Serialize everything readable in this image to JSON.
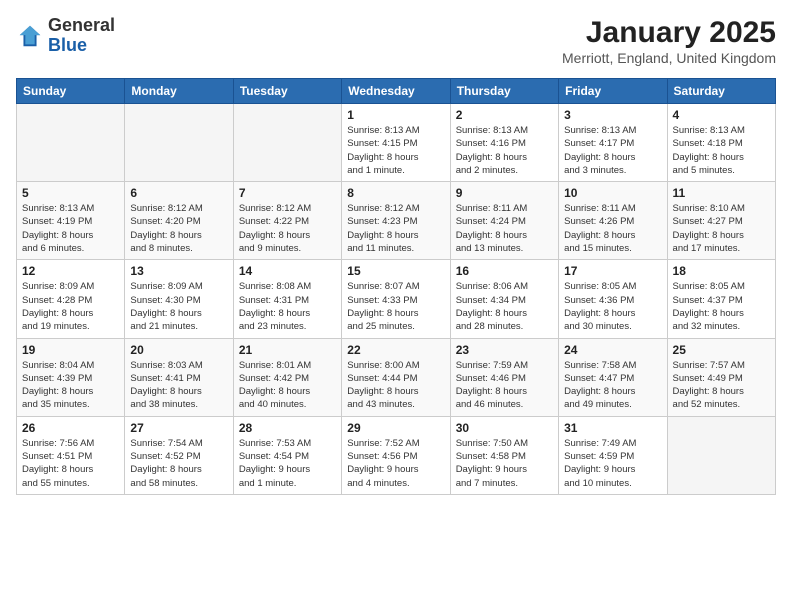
{
  "header": {
    "logo_general": "General",
    "logo_blue": "Blue",
    "month_title": "January 2025",
    "location": "Merriott, England, United Kingdom"
  },
  "weekdays": [
    "Sunday",
    "Monday",
    "Tuesday",
    "Wednesday",
    "Thursday",
    "Friday",
    "Saturday"
  ],
  "weeks": [
    [
      {
        "day": "",
        "info": ""
      },
      {
        "day": "",
        "info": ""
      },
      {
        "day": "",
        "info": ""
      },
      {
        "day": "1",
        "info": "Sunrise: 8:13 AM\nSunset: 4:15 PM\nDaylight: 8 hours\nand 1 minute."
      },
      {
        "day": "2",
        "info": "Sunrise: 8:13 AM\nSunset: 4:16 PM\nDaylight: 8 hours\nand 2 minutes."
      },
      {
        "day": "3",
        "info": "Sunrise: 8:13 AM\nSunset: 4:17 PM\nDaylight: 8 hours\nand 3 minutes."
      },
      {
        "day": "4",
        "info": "Sunrise: 8:13 AM\nSunset: 4:18 PM\nDaylight: 8 hours\nand 5 minutes."
      }
    ],
    [
      {
        "day": "5",
        "info": "Sunrise: 8:13 AM\nSunset: 4:19 PM\nDaylight: 8 hours\nand 6 minutes."
      },
      {
        "day": "6",
        "info": "Sunrise: 8:12 AM\nSunset: 4:20 PM\nDaylight: 8 hours\nand 8 minutes."
      },
      {
        "day": "7",
        "info": "Sunrise: 8:12 AM\nSunset: 4:22 PM\nDaylight: 8 hours\nand 9 minutes."
      },
      {
        "day": "8",
        "info": "Sunrise: 8:12 AM\nSunset: 4:23 PM\nDaylight: 8 hours\nand 11 minutes."
      },
      {
        "day": "9",
        "info": "Sunrise: 8:11 AM\nSunset: 4:24 PM\nDaylight: 8 hours\nand 13 minutes."
      },
      {
        "day": "10",
        "info": "Sunrise: 8:11 AM\nSunset: 4:26 PM\nDaylight: 8 hours\nand 15 minutes."
      },
      {
        "day": "11",
        "info": "Sunrise: 8:10 AM\nSunset: 4:27 PM\nDaylight: 8 hours\nand 17 minutes."
      }
    ],
    [
      {
        "day": "12",
        "info": "Sunrise: 8:09 AM\nSunset: 4:28 PM\nDaylight: 8 hours\nand 19 minutes."
      },
      {
        "day": "13",
        "info": "Sunrise: 8:09 AM\nSunset: 4:30 PM\nDaylight: 8 hours\nand 21 minutes."
      },
      {
        "day": "14",
        "info": "Sunrise: 8:08 AM\nSunset: 4:31 PM\nDaylight: 8 hours\nand 23 minutes."
      },
      {
        "day": "15",
        "info": "Sunrise: 8:07 AM\nSunset: 4:33 PM\nDaylight: 8 hours\nand 25 minutes."
      },
      {
        "day": "16",
        "info": "Sunrise: 8:06 AM\nSunset: 4:34 PM\nDaylight: 8 hours\nand 28 minutes."
      },
      {
        "day": "17",
        "info": "Sunrise: 8:05 AM\nSunset: 4:36 PM\nDaylight: 8 hours\nand 30 minutes."
      },
      {
        "day": "18",
        "info": "Sunrise: 8:05 AM\nSunset: 4:37 PM\nDaylight: 8 hours\nand 32 minutes."
      }
    ],
    [
      {
        "day": "19",
        "info": "Sunrise: 8:04 AM\nSunset: 4:39 PM\nDaylight: 8 hours\nand 35 minutes."
      },
      {
        "day": "20",
        "info": "Sunrise: 8:03 AM\nSunset: 4:41 PM\nDaylight: 8 hours\nand 38 minutes."
      },
      {
        "day": "21",
        "info": "Sunrise: 8:01 AM\nSunset: 4:42 PM\nDaylight: 8 hours\nand 40 minutes."
      },
      {
        "day": "22",
        "info": "Sunrise: 8:00 AM\nSunset: 4:44 PM\nDaylight: 8 hours\nand 43 minutes."
      },
      {
        "day": "23",
        "info": "Sunrise: 7:59 AM\nSunset: 4:46 PM\nDaylight: 8 hours\nand 46 minutes."
      },
      {
        "day": "24",
        "info": "Sunrise: 7:58 AM\nSunset: 4:47 PM\nDaylight: 8 hours\nand 49 minutes."
      },
      {
        "day": "25",
        "info": "Sunrise: 7:57 AM\nSunset: 4:49 PM\nDaylight: 8 hours\nand 52 minutes."
      }
    ],
    [
      {
        "day": "26",
        "info": "Sunrise: 7:56 AM\nSunset: 4:51 PM\nDaylight: 8 hours\nand 55 minutes."
      },
      {
        "day": "27",
        "info": "Sunrise: 7:54 AM\nSunset: 4:52 PM\nDaylight: 8 hours\nand 58 minutes."
      },
      {
        "day": "28",
        "info": "Sunrise: 7:53 AM\nSunset: 4:54 PM\nDaylight: 9 hours\nand 1 minute."
      },
      {
        "day": "29",
        "info": "Sunrise: 7:52 AM\nSunset: 4:56 PM\nDaylight: 9 hours\nand 4 minutes."
      },
      {
        "day": "30",
        "info": "Sunrise: 7:50 AM\nSunset: 4:58 PM\nDaylight: 9 hours\nand 7 minutes."
      },
      {
        "day": "31",
        "info": "Sunrise: 7:49 AM\nSunset: 4:59 PM\nDaylight: 9 hours\nand 10 minutes."
      },
      {
        "day": "",
        "info": ""
      }
    ]
  ]
}
